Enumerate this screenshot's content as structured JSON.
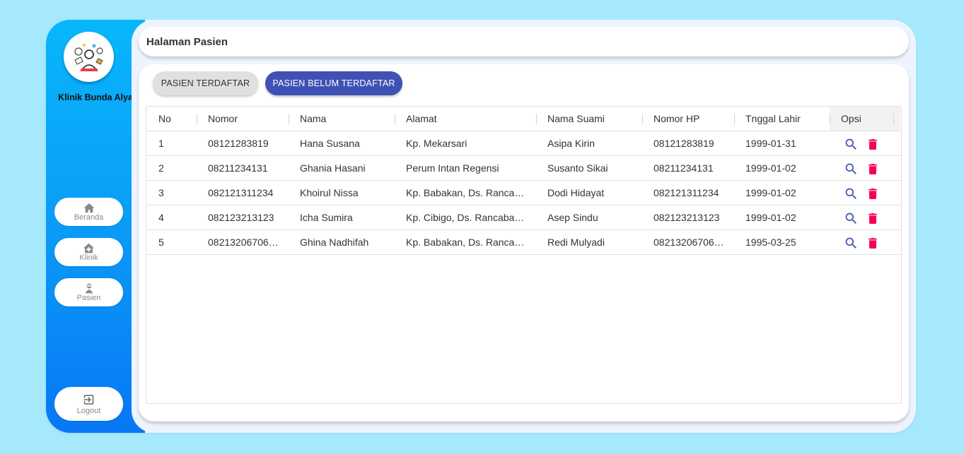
{
  "app": {
    "clinic_name": "Klinik Bunda Alya",
    "page_title": "Halaman Pasien"
  },
  "nav": {
    "home": {
      "label": "Beranda",
      "icon": "home-icon"
    },
    "clinic": {
      "label": "Klinik",
      "icon": "clinic-icon"
    },
    "patient": {
      "label": "Pasien",
      "icon": "patient-icon"
    },
    "logout": {
      "label": "Logout",
      "icon": "logout-icon"
    }
  },
  "tabs": {
    "registered": "PASIEN TERDAFTAR",
    "unregistered": "PASIEN BELUM TERDAFTAR"
  },
  "table": {
    "columns": [
      "No",
      "Nomor",
      "Nama",
      "Alamat",
      "Nama Suami",
      "Nomor HP",
      "Tnggal Lahir",
      "Opsi"
    ],
    "rows": [
      [
        "1",
        "08121283819",
        "Hana Susana",
        "Kp. Mekarsari",
        "Asipa Kirin",
        "08121283819",
        "1999-01-31"
      ],
      [
        "2",
        "08211234131",
        "Ghania Hasani",
        "Perum Intan Regensi",
        "Susanto Sikai",
        "08211234131",
        "1999-01-02"
      ],
      [
        "3",
        "082121311234",
        "Khoirul Nissa",
        "Kp. Babakan, Ds. Ranca…",
        "Dodi Hidayat",
        "082121311234",
        "1999-01-02"
      ],
      [
        "4",
        "082123213123",
        "Icha Sumira",
        "Kp. Cibigo, Ds. Rancaba…",
        "Asep Sindu",
        "082123213123",
        "1999-01-02"
      ],
      [
        "5",
        "08213206706…",
        "Ghina Nadhifah",
        "Kp. Babakan, Ds. Ranca…",
        "Redi Mulyadi",
        "08213206706…",
        "1995-03-25"
      ]
    ]
  },
  "colors": {
    "background": "#a6e8fc",
    "sidebar_top": "#08b6fb",
    "sidebar_bottom": "#0877f5",
    "primary": "#3f51b5",
    "delete": "#f50057"
  }
}
